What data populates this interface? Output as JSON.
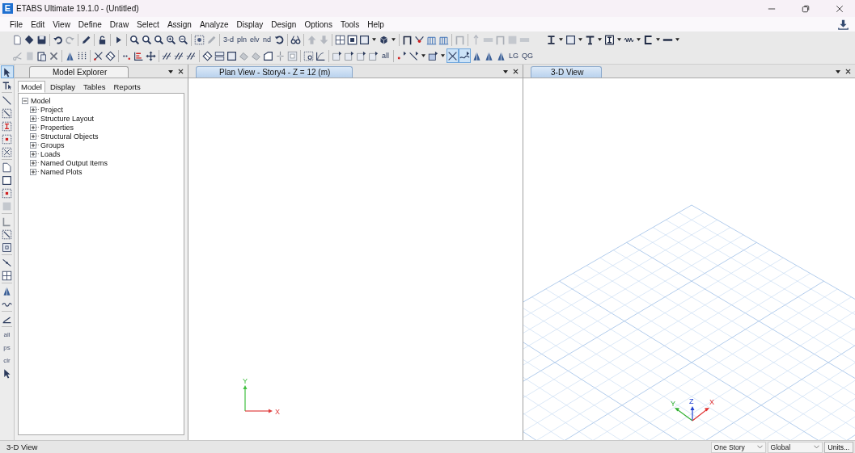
{
  "window": {
    "logo": "E",
    "title": "ETABS Ultimate 19.1.0 - (Untitled)"
  },
  "menu": [
    "File",
    "Edit",
    "View",
    "Define",
    "Draw",
    "Select",
    "Assign",
    "Analyze",
    "Display",
    "Design",
    "Options",
    "Tools",
    "Help"
  ],
  "toolbars": [
    [
      {
        "kind": "button",
        "selected": false
      },
      {
        "kind": "button",
        "selected": false
      },
      {
        "kind": "button",
        "selected": false
      },
      {
        "kind": "separator"
      },
      {
        "kind": "button",
        "selected": false
      },
      {
        "kind": "button",
        "selected": false
      },
      {
        "kind": "separator"
      },
      {
        "kind": "button",
        "selected": false
      },
      {
        "kind": "separator"
      },
      {
        "kind": "button",
        "selected": false
      },
      {
        "kind": "separator"
      },
      {
        "kind": "button",
        "selected": false
      },
      {
        "kind": "separator"
      },
      {
        "kind": "button",
        "selected": false
      },
      {
        "kind": "button",
        "selected": false
      },
      {
        "kind": "button",
        "selected": false
      },
      {
        "kind": "button",
        "selected": false
      },
      {
        "kind": "button",
        "selected": false
      },
      {
        "kind": "separator"
      },
      {
        "kind": "button",
        "selected": false
      },
      {
        "kind": "button",
        "selected": false
      },
      {
        "kind": "separator"
      },
      {
        "kind": "text",
        "label": "3-d",
        "selected": false
      },
      {
        "kind": "text",
        "label": "pln",
        "selected": false
      },
      {
        "kind": "text",
        "label": "elv",
        "selected": false
      },
      {
        "kind": "text",
        "label": "nd",
        "selected": false
      },
      {
        "kind": "button",
        "selected": false
      },
      {
        "kind": "separator"
      },
      {
        "kind": "button",
        "selected": false
      },
      {
        "kind": "separator"
      },
      {
        "kind": "button",
        "selected": false
      },
      {
        "kind": "button",
        "selected": false
      },
      {
        "kind": "separator"
      },
      {
        "kind": "button",
        "selected": false
      },
      {
        "kind": "button",
        "selected": false
      },
      {
        "kind": "button",
        "selected": false
      },
      {
        "kind": "dropdown"
      },
      {
        "kind": "button",
        "selected": false
      },
      {
        "kind": "dropdown"
      },
      {
        "kind": "separator"
      },
      {
        "kind": "button",
        "selected": false
      },
      {
        "kind": "button",
        "selected": false
      },
      {
        "kind": "button",
        "selected": false
      },
      {
        "kind": "button",
        "selected": false
      },
      {
        "kind": "separator"
      },
      {
        "kind": "button",
        "selected": false
      },
      {
        "kind": "separator"
      },
      {
        "kind": "button",
        "selected": false
      },
      {
        "kind": "button",
        "selected": false
      },
      {
        "kind": "button",
        "selected": false
      },
      {
        "kind": "button",
        "selected": false
      },
      {
        "kind": "button",
        "selected": false
      },
      {
        "kind": "gap"
      },
      {
        "kind": "button",
        "selected": false
      },
      {
        "kind": "dropdown"
      },
      {
        "kind": "button",
        "selected": false
      },
      {
        "kind": "dropdown"
      },
      {
        "kind": "button",
        "selected": false
      },
      {
        "kind": "dropdown"
      },
      {
        "kind": "button",
        "selected": false
      },
      {
        "kind": "dropdown"
      },
      {
        "kind": "button",
        "selected": false
      },
      {
        "kind": "dropdown"
      },
      {
        "kind": "button",
        "selected": false
      },
      {
        "kind": "dropdown"
      },
      {
        "kind": "button",
        "selected": false
      },
      {
        "kind": "dropdown"
      }
    ],
    [
      {
        "kind": "button",
        "selected": false
      },
      {
        "kind": "button",
        "selected": false
      },
      {
        "kind": "button",
        "selected": false
      },
      {
        "kind": "button",
        "selected": false
      },
      {
        "kind": "separator"
      },
      {
        "kind": "button",
        "selected": false
      },
      {
        "kind": "button",
        "selected": false
      },
      {
        "kind": "separator"
      },
      {
        "kind": "button",
        "selected": false
      },
      {
        "kind": "button",
        "selected": false
      },
      {
        "kind": "separator"
      },
      {
        "kind": "button",
        "selected": false
      },
      {
        "kind": "button",
        "selected": false
      },
      {
        "kind": "button",
        "selected": false
      },
      {
        "kind": "separator"
      },
      {
        "kind": "button",
        "selected": false
      },
      {
        "kind": "button",
        "selected": false
      },
      {
        "kind": "button",
        "selected": false
      },
      {
        "kind": "separator"
      },
      {
        "kind": "button",
        "selected": false
      },
      {
        "kind": "button",
        "selected": false
      },
      {
        "kind": "button",
        "selected": false
      },
      {
        "kind": "button",
        "selected": false
      },
      {
        "kind": "button",
        "selected": false
      },
      {
        "kind": "button",
        "selected": false
      },
      {
        "kind": "button",
        "selected": false
      },
      {
        "kind": "button",
        "selected": false
      },
      {
        "kind": "separator"
      },
      {
        "kind": "button",
        "selected": false
      },
      {
        "kind": "button",
        "selected": false
      },
      {
        "kind": "separator"
      },
      {
        "kind": "button",
        "selected": false
      },
      {
        "kind": "button",
        "selected": false
      },
      {
        "kind": "button",
        "selected": false
      },
      {
        "kind": "button",
        "selected": false
      },
      {
        "kind": "text",
        "label": "all",
        "selected": false
      },
      {
        "kind": "separator"
      },
      {
        "kind": "button",
        "selected": false
      },
      {
        "kind": "button",
        "selected": false
      },
      {
        "kind": "dropdown"
      },
      {
        "kind": "button",
        "selected": false
      },
      {
        "kind": "dropdown"
      },
      {
        "kind": "button",
        "selected": true
      },
      {
        "kind": "button",
        "selected": true
      },
      {
        "kind": "button",
        "selected": false
      },
      {
        "kind": "button",
        "selected": false
      },
      {
        "kind": "button",
        "selected": false
      },
      {
        "kind": "text",
        "label": "LG",
        "selected": false
      },
      {
        "kind": "text",
        "label": "QG",
        "selected": false
      }
    ]
  ],
  "side_toolbar": [
    {
      "kind": "button",
      "selected": true
    },
    {
      "kind": "button",
      "selected": false
    },
    {
      "kind": "separator"
    },
    {
      "kind": "button",
      "selected": false
    },
    {
      "kind": "button",
      "selected": false
    },
    {
      "kind": "button",
      "selected": false
    },
    {
      "kind": "button",
      "selected": false
    },
    {
      "kind": "button",
      "selected": false
    },
    {
      "kind": "separator"
    },
    {
      "kind": "button",
      "selected": false
    },
    {
      "kind": "button",
      "selected": false
    },
    {
      "kind": "button",
      "selected": false
    },
    {
      "kind": "button",
      "selected": false
    },
    {
      "kind": "separator"
    },
    {
      "kind": "button",
      "selected": false
    },
    {
      "kind": "button",
      "selected": false
    },
    {
      "kind": "button",
      "selected": false
    },
    {
      "kind": "separator"
    },
    {
      "kind": "button",
      "selected": false
    },
    {
      "kind": "button",
      "selected": false
    },
    {
      "kind": "separator"
    },
    {
      "kind": "button",
      "selected": false
    },
    {
      "kind": "button",
      "selected": false
    },
    {
      "kind": "separator"
    },
    {
      "kind": "button",
      "selected": false
    },
    {
      "kind": "separator"
    },
    {
      "kind": "text",
      "label": "all",
      "selected": false
    },
    {
      "kind": "text",
      "label": "ps",
      "selected": false
    },
    {
      "kind": "text",
      "label": "clr",
      "selected": false
    },
    {
      "kind": "button",
      "selected": false
    }
  ],
  "model_explorer": {
    "title": "Model Explorer",
    "tabs": [
      {
        "label": "Model",
        "selected": true
      },
      {
        "label": "Display",
        "selected": false
      },
      {
        "label": "Tables",
        "selected": false
      },
      {
        "label": "Reports",
        "selected": false
      }
    ],
    "tree": {
      "label": "Model",
      "expanded": true,
      "children": [
        {
          "label": "Project",
          "expanded": false
        },
        {
          "label": "Structure Layout",
          "expanded": false
        },
        {
          "label": "Properties",
          "expanded": false
        },
        {
          "label": "Structural Objects",
          "expanded": false
        },
        {
          "label": "Groups",
          "expanded": false
        },
        {
          "label": "Loads",
          "expanded": false
        },
        {
          "label": "Named Output Items",
          "expanded": false
        },
        {
          "label": "Named Plots",
          "expanded": false
        }
      ]
    }
  },
  "plan_view": {
    "title": "Plan View - Story4 - Z = 12 (m)",
    "axes": {
      "y": "Y",
      "x": "X"
    }
  },
  "view_3d": {
    "title": "3-D View",
    "axes": {
      "y": "Y",
      "z": "Z",
      "x": "X"
    }
  },
  "status_bar": {
    "text": "3-D View",
    "story": "One Story",
    "coordinates": "Global",
    "units_button": "Units..."
  }
}
